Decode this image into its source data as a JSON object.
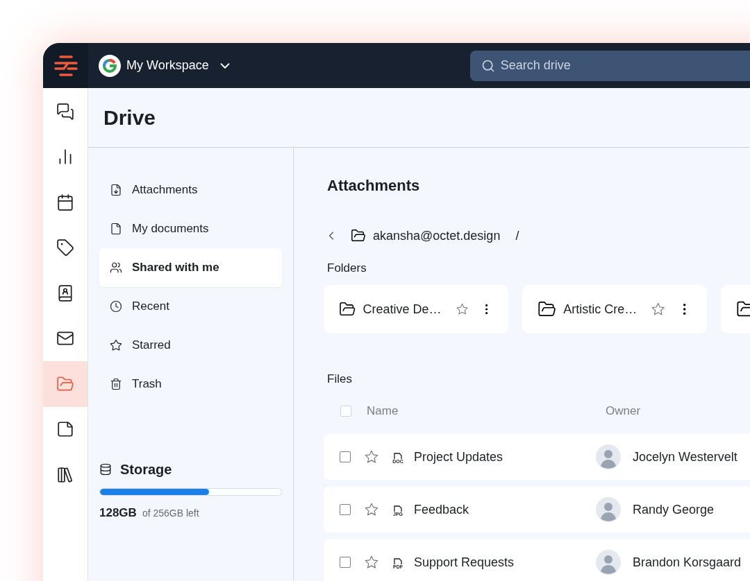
{
  "workspace": {
    "name": "My Workspace"
  },
  "search": {
    "placeholder": "Search drive"
  },
  "rail": [
    {
      "kind": "chat",
      "selected": false
    },
    {
      "kind": "chart",
      "selected": false
    },
    {
      "kind": "calendar",
      "selected": false
    },
    {
      "kind": "tag",
      "selected": false
    },
    {
      "kind": "contacts",
      "selected": false
    },
    {
      "kind": "mail",
      "selected": false
    },
    {
      "kind": "folder",
      "selected": true
    },
    {
      "kind": "notes",
      "selected": false
    },
    {
      "kind": "books",
      "selected": false
    }
  ],
  "page_title": "Drive",
  "sidebar": {
    "items": [
      {
        "kind": "attachments",
        "label": "Attachments",
        "selected": false
      },
      {
        "kind": "documents",
        "label": "My documents",
        "selected": false
      },
      {
        "kind": "shared",
        "label": "Shared with me",
        "selected": true
      },
      {
        "kind": "recent",
        "label": "Recent",
        "selected": false
      },
      {
        "kind": "starred",
        "label": "Starred",
        "selected": false
      },
      {
        "kind": "trash",
        "label": "Trash",
        "selected": false
      }
    ],
    "storage": {
      "title": "Storage",
      "used": "128GB",
      "total": "of 256GB left",
      "level": 0.6
    }
  },
  "content": {
    "title": "Attachments",
    "breadcrumb": "akansha@octet.design",
    "separator": "/",
    "folders": {
      "heading": "Folders",
      "items": [
        {
          "kind": "full",
          "name": "Creative De…",
          "starred": false
        },
        {
          "kind": "full",
          "name": "Artistic Cre…",
          "starred": false
        },
        {
          "kind": "cut"
        }
      ]
    },
    "files": {
      "heading": "Files",
      "header_checked": false,
      "columns": [
        "Name",
        "Owner"
      ],
      "rows": [
        {
          "type": "DOC",
          "name": "Project Updates",
          "owner": "Jocelyn Westervelt",
          "checked": false,
          "starred": false
        },
        {
          "type": "JPG",
          "name": "Feedback",
          "owner": "Randy George",
          "checked": false,
          "starred": false
        },
        {
          "type": "PDF",
          "name": "Support Requests",
          "owner": "Brandon Korsgaard",
          "checked": false,
          "starred": false
        }
      ]
    }
  }
}
